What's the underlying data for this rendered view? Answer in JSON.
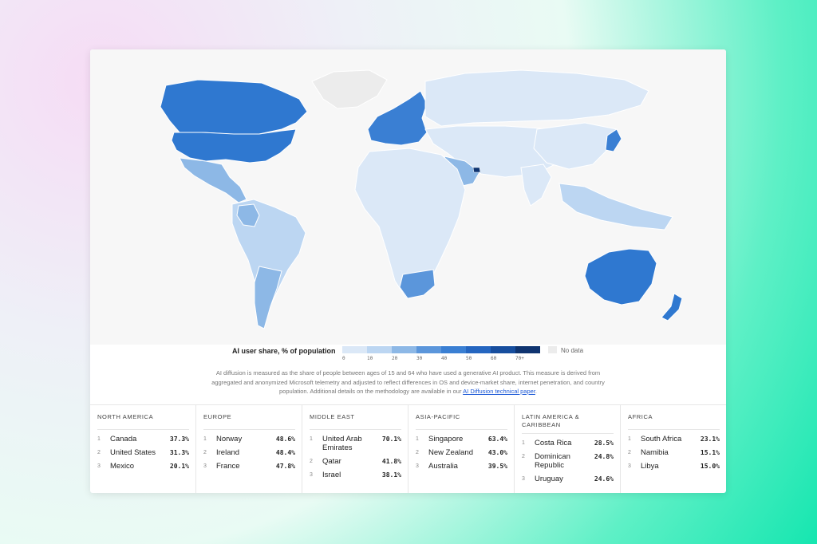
{
  "legend": {
    "title": "AI user share, % of population",
    "ticks": [
      "0",
      "10",
      "20",
      "30",
      "40",
      "50",
      "60",
      "70+"
    ],
    "colors": [
      "#dbe8f7",
      "#bcd6f2",
      "#8db8e6",
      "#5b96db",
      "#3a7fd3",
      "#2566c0",
      "#174e9e",
      "#0f3470"
    ],
    "no_data": "No data",
    "no_data_color": "#ececec"
  },
  "description": {
    "text": "AI diffusion is measured as the share of people between ages of 15 and 64 who have used a generative AI product. This measure is derived from aggregated and anonymized Microsoft telemetry and adjusted to reflect differences in OS and device-market share, internet penetration, and country population. Additional details on the methodology are available in our ",
    "link": "AI Diffusion technical paper",
    "end": "."
  },
  "regions": [
    {
      "title": "NORTH AMERICA",
      "rows": [
        {
          "rank": "1",
          "country": "Canada",
          "value": "37.3%"
        },
        {
          "rank": "2",
          "country": "United States",
          "value": "31.3%"
        },
        {
          "rank": "3",
          "country": "Mexico",
          "value": "20.1%"
        }
      ]
    },
    {
      "title": "EUROPE",
      "rows": [
        {
          "rank": "1",
          "country": "Norway",
          "value": "48.6%"
        },
        {
          "rank": "2",
          "country": "Ireland",
          "value": "48.4%"
        },
        {
          "rank": "3",
          "country": "France",
          "value": "47.8%"
        }
      ]
    },
    {
      "title": "MIDDLE EAST",
      "rows": [
        {
          "rank": "1",
          "country": "United Arab Emirates",
          "value": "70.1%"
        },
        {
          "rank": "2",
          "country": "Qatar",
          "value": "41.8%"
        },
        {
          "rank": "3",
          "country": "Israel",
          "value": "38.1%"
        }
      ]
    },
    {
      "title": "ASIA-PACIFIC",
      "rows": [
        {
          "rank": "1",
          "country": "Singapore",
          "value": "63.4%"
        },
        {
          "rank": "2",
          "country": "New Zealand",
          "value": "43.0%"
        },
        {
          "rank": "3",
          "country": "Australia",
          "value": "39.5%"
        }
      ]
    },
    {
      "title": "LATIN AMERICA & CARIBBEAN",
      "rows": [
        {
          "rank": "1",
          "country": "Costa Rica",
          "value": "28.5%"
        },
        {
          "rank": "2",
          "country": "Dominican Republic",
          "value": "24.8%"
        },
        {
          "rank": "3",
          "country": "Uruguay",
          "value": "24.6%"
        }
      ]
    },
    {
      "title": "AFRICA",
      "rows": [
        {
          "rank": "1",
          "country": "South Africa",
          "value": "23.1%"
        },
        {
          "rank": "2",
          "country": "Namibia",
          "value": "15.1%"
        },
        {
          "rank": "3",
          "country": "Libya",
          "value": "15.0%"
        }
      ]
    }
  ]
}
